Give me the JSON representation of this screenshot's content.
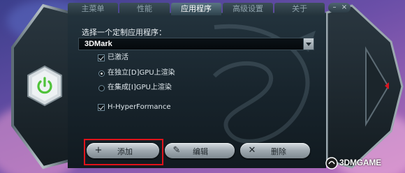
{
  "tabs": [
    {
      "label": "主菜单",
      "active": false
    },
    {
      "label": "性能",
      "active": false
    },
    {
      "label": "应用程序",
      "active": true
    },
    {
      "label": "高级设置",
      "active": false
    },
    {
      "label": "关于",
      "active": false
    }
  ],
  "window_controls": {
    "minimize": "–",
    "close": "×"
  },
  "app_section": {
    "prompt": "选择一个定制应用程序：",
    "selected_app": "3DMark",
    "activated_label": "已激活",
    "activated": true,
    "render_options": [
      {
        "label": "在独立[D]GPU上渲染",
        "selected": true
      },
      {
        "label": "在集成[I]GPU上渲染",
        "selected": false
      }
    ],
    "hyperformance_label": "H-HyperFormance",
    "hyperformance": true
  },
  "buttons": {
    "add": {
      "label": "添加",
      "icon": "plus-icon"
    },
    "edit": {
      "label": "编辑",
      "icon": "pencil-icon"
    },
    "delete": {
      "label": "删除",
      "icon": "x-icon"
    }
  },
  "watermark": {
    "text": "3DMGAME"
  },
  "colors": {
    "panel_bg": "#17232b",
    "highlight": "#e0121a",
    "power_green": "#4fc23a",
    "accent_red": "#d91520"
  }
}
